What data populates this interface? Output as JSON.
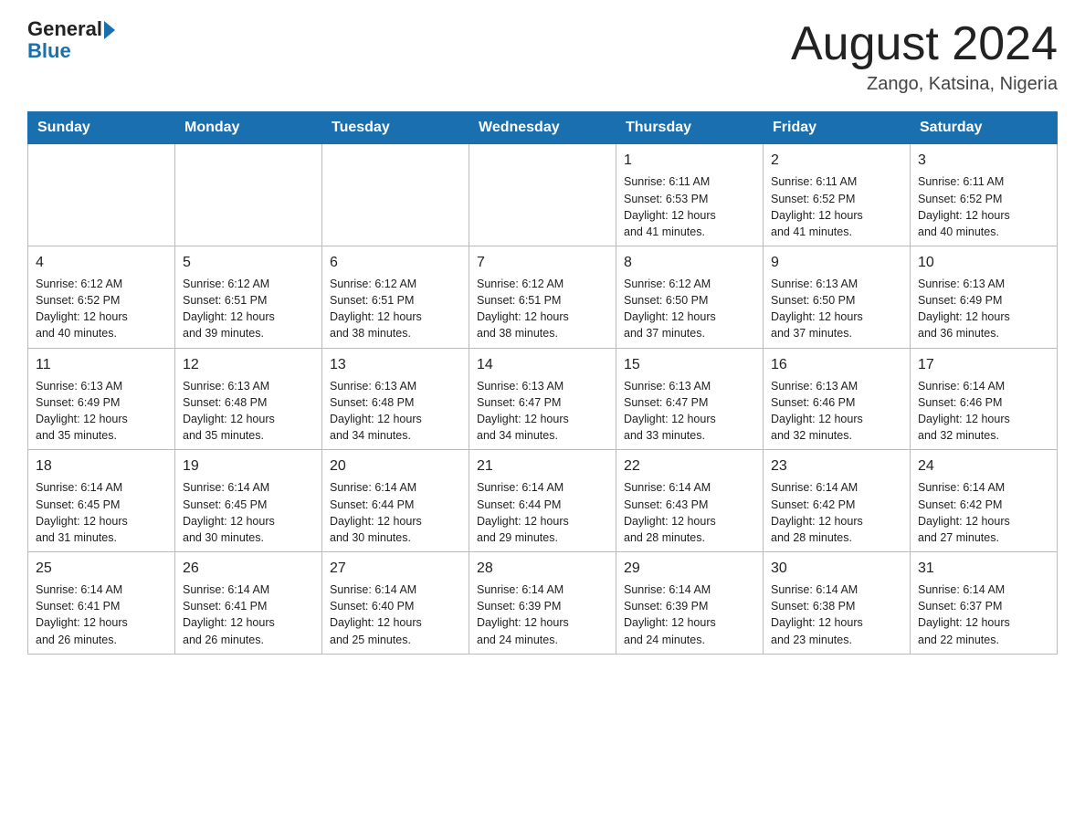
{
  "header": {
    "logo_text_general": "General",
    "logo_text_blue": "Blue",
    "month_title": "August 2024",
    "location": "Zango, Katsina, Nigeria"
  },
  "days_of_week": [
    "Sunday",
    "Monday",
    "Tuesday",
    "Wednesday",
    "Thursday",
    "Friday",
    "Saturday"
  ],
  "weeks": [
    [
      {
        "day": "",
        "info": ""
      },
      {
        "day": "",
        "info": ""
      },
      {
        "day": "",
        "info": ""
      },
      {
        "day": "",
        "info": ""
      },
      {
        "day": "1",
        "info": "Sunrise: 6:11 AM\nSunset: 6:53 PM\nDaylight: 12 hours\nand 41 minutes."
      },
      {
        "day": "2",
        "info": "Sunrise: 6:11 AM\nSunset: 6:52 PM\nDaylight: 12 hours\nand 41 minutes."
      },
      {
        "day": "3",
        "info": "Sunrise: 6:11 AM\nSunset: 6:52 PM\nDaylight: 12 hours\nand 40 minutes."
      }
    ],
    [
      {
        "day": "4",
        "info": "Sunrise: 6:12 AM\nSunset: 6:52 PM\nDaylight: 12 hours\nand 40 minutes."
      },
      {
        "day": "5",
        "info": "Sunrise: 6:12 AM\nSunset: 6:51 PM\nDaylight: 12 hours\nand 39 minutes."
      },
      {
        "day": "6",
        "info": "Sunrise: 6:12 AM\nSunset: 6:51 PM\nDaylight: 12 hours\nand 38 minutes."
      },
      {
        "day": "7",
        "info": "Sunrise: 6:12 AM\nSunset: 6:51 PM\nDaylight: 12 hours\nand 38 minutes."
      },
      {
        "day": "8",
        "info": "Sunrise: 6:12 AM\nSunset: 6:50 PM\nDaylight: 12 hours\nand 37 minutes."
      },
      {
        "day": "9",
        "info": "Sunrise: 6:13 AM\nSunset: 6:50 PM\nDaylight: 12 hours\nand 37 minutes."
      },
      {
        "day": "10",
        "info": "Sunrise: 6:13 AM\nSunset: 6:49 PM\nDaylight: 12 hours\nand 36 minutes."
      }
    ],
    [
      {
        "day": "11",
        "info": "Sunrise: 6:13 AM\nSunset: 6:49 PM\nDaylight: 12 hours\nand 35 minutes."
      },
      {
        "day": "12",
        "info": "Sunrise: 6:13 AM\nSunset: 6:48 PM\nDaylight: 12 hours\nand 35 minutes."
      },
      {
        "day": "13",
        "info": "Sunrise: 6:13 AM\nSunset: 6:48 PM\nDaylight: 12 hours\nand 34 minutes."
      },
      {
        "day": "14",
        "info": "Sunrise: 6:13 AM\nSunset: 6:47 PM\nDaylight: 12 hours\nand 34 minutes."
      },
      {
        "day": "15",
        "info": "Sunrise: 6:13 AM\nSunset: 6:47 PM\nDaylight: 12 hours\nand 33 minutes."
      },
      {
        "day": "16",
        "info": "Sunrise: 6:13 AM\nSunset: 6:46 PM\nDaylight: 12 hours\nand 32 minutes."
      },
      {
        "day": "17",
        "info": "Sunrise: 6:14 AM\nSunset: 6:46 PM\nDaylight: 12 hours\nand 32 minutes."
      }
    ],
    [
      {
        "day": "18",
        "info": "Sunrise: 6:14 AM\nSunset: 6:45 PM\nDaylight: 12 hours\nand 31 minutes."
      },
      {
        "day": "19",
        "info": "Sunrise: 6:14 AM\nSunset: 6:45 PM\nDaylight: 12 hours\nand 30 minutes."
      },
      {
        "day": "20",
        "info": "Sunrise: 6:14 AM\nSunset: 6:44 PM\nDaylight: 12 hours\nand 30 minutes."
      },
      {
        "day": "21",
        "info": "Sunrise: 6:14 AM\nSunset: 6:44 PM\nDaylight: 12 hours\nand 29 minutes."
      },
      {
        "day": "22",
        "info": "Sunrise: 6:14 AM\nSunset: 6:43 PM\nDaylight: 12 hours\nand 28 minutes."
      },
      {
        "day": "23",
        "info": "Sunrise: 6:14 AM\nSunset: 6:42 PM\nDaylight: 12 hours\nand 28 minutes."
      },
      {
        "day": "24",
        "info": "Sunrise: 6:14 AM\nSunset: 6:42 PM\nDaylight: 12 hours\nand 27 minutes."
      }
    ],
    [
      {
        "day": "25",
        "info": "Sunrise: 6:14 AM\nSunset: 6:41 PM\nDaylight: 12 hours\nand 26 minutes."
      },
      {
        "day": "26",
        "info": "Sunrise: 6:14 AM\nSunset: 6:41 PM\nDaylight: 12 hours\nand 26 minutes."
      },
      {
        "day": "27",
        "info": "Sunrise: 6:14 AM\nSunset: 6:40 PM\nDaylight: 12 hours\nand 25 minutes."
      },
      {
        "day": "28",
        "info": "Sunrise: 6:14 AM\nSunset: 6:39 PM\nDaylight: 12 hours\nand 24 minutes."
      },
      {
        "day": "29",
        "info": "Sunrise: 6:14 AM\nSunset: 6:39 PM\nDaylight: 12 hours\nand 24 minutes."
      },
      {
        "day": "30",
        "info": "Sunrise: 6:14 AM\nSunset: 6:38 PM\nDaylight: 12 hours\nand 23 minutes."
      },
      {
        "day": "31",
        "info": "Sunrise: 6:14 AM\nSunset: 6:37 PM\nDaylight: 12 hours\nand 22 minutes."
      }
    ]
  ]
}
